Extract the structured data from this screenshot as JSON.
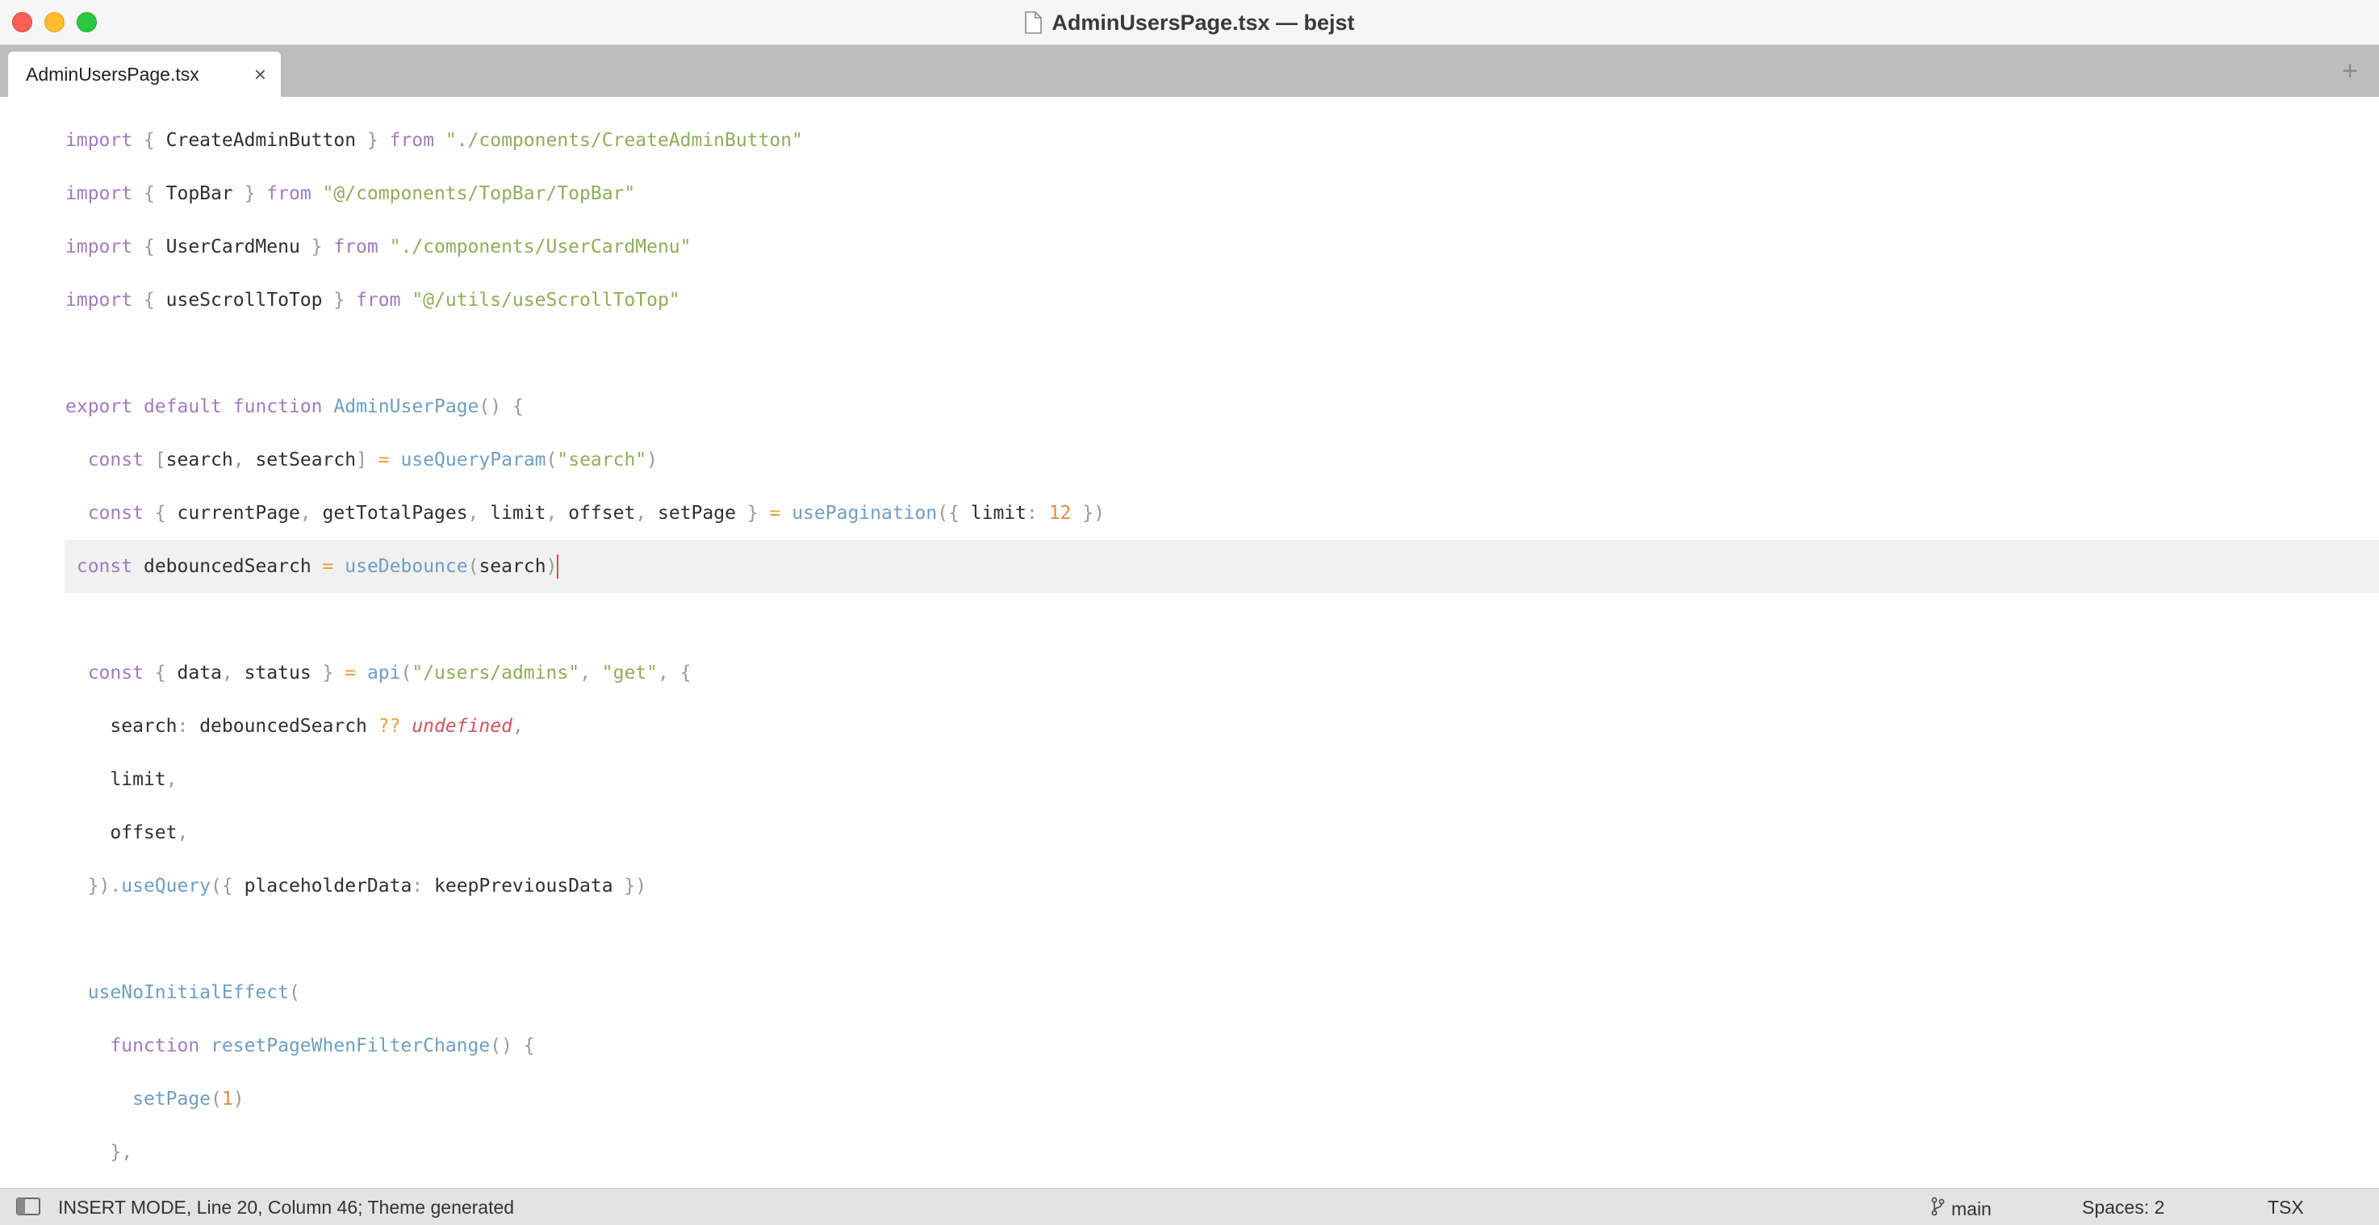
{
  "window": {
    "title": "AdminUsersPage.tsx — bejst"
  },
  "tabs": [
    {
      "label": "AdminUsersPage.tsx",
      "close": "×"
    }
  ],
  "tabbar": {
    "add": "+"
  },
  "editor": {
    "lines": [
      [
        [
          "kw",
          "import"
        ],
        [
          "pn",
          " { "
        ],
        [
          "id",
          "CreateAdminButton"
        ],
        [
          "pn",
          " } "
        ],
        [
          "kw",
          "from"
        ],
        [
          "pn",
          " "
        ],
        [
          "str",
          "\"./components/CreateAdminButton\""
        ]
      ],
      [
        [
          "kw",
          "import"
        ],
        [
          "pn",
          " { "
        ],
        [
          "id",
          "TopBar"
        ],
        [
          "pn",
          " } "
        ],
        [
          "kw",
          "from"
        ],
        [
          "pn",
          " "
        ],
        [
          "str",
          "\"@/components/TopBar/TopBar\""
        ]
      ],
      [
        [
          "kw",
          "import"
        ],
        [
          "pn",
          " { "
        ],
        [
          "id",
          "UserCardMenu"
        ],
        [
          "pn",
          " } "
        ],
        [
          "kw",
          "from"
        ],
        [
          "pn",
          " "
        ],
        [
          "str",
          "\"./components/UserCardMenu\""
        ]
      ],
      [
        [
          "kw",
          "import"
        ],
        [
          "pn",
          " { "
        ],
        [
          "id",
          "useScrollToTop"
        ],
        [
          "pn",
          " } "
        ],
        [
          "kw",
          "from"
        ],
        [
          "pn",
          " "
        ],
        [
          "str",
          "\"@/utils/useScrollToTop\""
        ]
      ],
      [],
      [
        [
          "kw",
          "export"
        ],
        [
          "pn",
          " "
        ],
        [
          "kw",
          "default"
        ],
        [
          "pn",
          " "
        ],
        [
          "kw",
          "function"
        ],
        [
          "pn",
          " "
        ],
        [
          "fn",
          "AdminUserPage"
        ],
        [
          "pn",
          "() {"
        ]
      ],
      [
        [
          "pn",
          "  "
        ],
        [
          "kw",
          "const"
        ],
        [
          "pn",
          " ["
        ],
        [
          "id",
          "search"
        ],
        [
          "pn",
          ", "
        ],
        [
          "id",
          "setSearch"
        ],
        [
          "pn",
          "] "
        ],
        [
          "op",
          "="
        ],
        [
          "pn",
          " "
        ],
        [
          "fn",
          "useQueryParam"
        ],
        [
          "pn",
          "("
        ],
        [
          "str",
          "\"search\""
        ],
        [
          "pn",
          ")"
        ]
      ],
      [
        [
          "pn",
          "  "
        ],
        [
          "kw",
          "const"
        ],
        [
          "pn",
          " { "
        ],
        [
          "id",
          "currentPage"
        ],
        [
          "pn",
          ", "
        ],
        [
          "id",
          "getTotalPages"
        ],
        [
          "pn",
          ", "
        ],
        [
          "id",
          "limit"
        ],
        [
          "pn",
          ", "
        ],
        [
          "id",
          "offset"
        ],
        [
          "pn",
          ", "
        ],
        [
          "id",
          "setPage"
        ],
        [
          "pn",
          " } "
        ],
        [
          "op",
          "="
        ],
        [
          "pn",
          " "
        ],
        [
          "fn",
          "usePagination"
        ],
        [
          "pn",
          "({ "
        ],
        [
          "id",
          "limit"
        ],
        [
          "pn",
          ": "
        ],
        [
          "num",
          "12"
        ],
        [
          "pn",
          " })"
        ]
      ],
      [
        [
          "pn",
          " "
        ],
        [
          "kw",
          "const"
        ],
        [
          "pn",
          " "
        ],
        [
          "id",
          "debouncedSearch"
        ],
        [
          "pn",
          " "
        ],
        [
          "op",
          "="
        ],
        [
          "pn",
          " "
        ],
        [
          "fn",
          "useDebounce"
        ],
        [
          "pn",
          "("
        ],
        [
          "id",
          "search"
        ],
        [
          "pn",
          ")"
        ],
        [
          "cursor",
          ""
        ]
      ],
      [],
      [
        [
          "pn",
          "  "
        ],
        [
          "kw",
          "const"
        ],
        [
          "pn",
          " { "
        ],
        [
          "id",
          "data"
        ],
        [
          "pn",
          ", "
        ],
        [
          "id",
          "status"
        ],
        [
          "pn",
          " } "
        ],
        [
          "op",
          "="
        ],
        [
          "pn",
          " "
        ],
        [
          "fn",
          "api"
        ],
        [
          "pn",
          "("
        ],
        [
          "str",
          "\"/users/admins\""
        ],
        [
          "pn",
          ", "
        ],
        [
          "str",
          "\"get\""
        ],
        [
          "pn",
          ", {"
        ]
      ],
      [
        [
          "pn",
          "    "
        ],
        [
          "id",
          "search"
        ],
        [
          "pn",
          ": "
        ],
        [
          "id",
          "debouncedSearch"
        ],
        [
          "pn",
          " "
        ],
        [
          "op",
          "??"
        ],
        [
          "pn",
          " "
        ],
        [
          "undef",
          "undefined"
        ],
        [
          "pn",
          ","
        ]
      ],
      [
        [
          "pn",
          "    "
        ],
        [
          "id",
          "limit"
        ],
        [
          "pn",
          ","
        ]
      ],
      [
        [
          "pn",
          "    "
        ],
        [
          "id",
          "offset"
        ],
        [
          "pn",
          ","
        ]
      ],
      [
        [
          "pn",
          "  })."
        ],
        [
          "fn",
          "useQuery"
        ],
        [
          "pn",
          "({ "
        ],
        [
          "id",
          "placeholderData"
        ],
        [
          "pn",
          ": "
        ],
        [
          "id",
          "keepPreviousData"
        ],
        [
          "pn",
          " })"
        ]
      ],
      [],
      [
        [
          "pn",
          "  "
        ],
        [
          "fn",
          "useNoInitialEffect"
        ],
        [
          "pn",
          "("
        ]
      ],
      [
        [
          "pn",
          "    "
        ],
        [
          "kw",
          "function"
        ],
        [
          "pn",
          " "
        ],
        [
          "fn",
          "resetPageWhenFilterChange"
        ],
        [
          "pn",
          "() {"
        ]
      ],
      [
        [
          "pn",
          "      "
        ],
        [
          "fn",
          "setPage"
        ],
        [
          "pn",
          "("
        ],
        [
          "num",
          "1"
        ],
        [
          "pn",
          ")"
        ]
      ],
      [
        [
          "pn",
          "    },"
        ]
      ]
    ],
    "current_line_index": 8
  },
  "statusbar": {
    "mode": "INSERT MODE, Line 20, Column 46; Theme generated",
    "branch": "main",
    "spaces": "Spaces: 2",
    "syntax": "TSX"
  },
  "icons": {
    "document": "document-icon",
    "sidebar_toggle": "sidebar-toggle-icon",
    "branch": "git-branch-icon"
  },
  "colors": {
    "keyword": "#a27bbf",
    "string": "#8fae59",
    "function": "#6f9ec2",
    "number": "#e08b40",
    "operator": "#e6a23c",
    "undefined": "#d2555a",
    "cursor": "#d94d4d"
  }
}
